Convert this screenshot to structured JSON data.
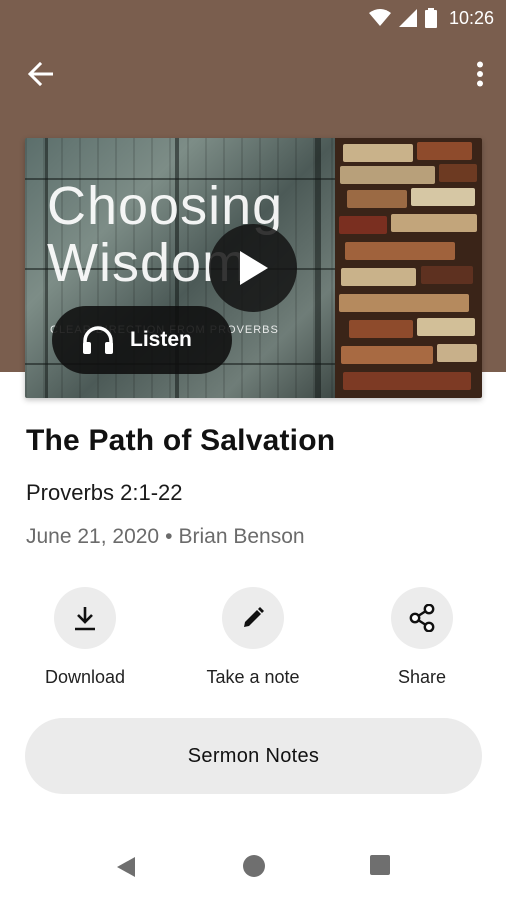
{
  "status_bar": {
    "time": "10:26"
  },
  "toolbar": {
    "back_icon": "arrow-left-icon",
    "menu_icon": "more-vertical-icon"
  },
  "media": {
    "artwork_title_line1": "Choosing",
    "artwork_title_line2": "Wisdom",
    "artwork_subtitle": "CLEAR DIRECTION FROM PROVERBS",
    "listen_label": "Listen"
  },
  "sermon": {
    "title": "The Path of Salvation",
    "passage": "Proverbs 2:1-22",
    "date": "June 21, 2020",
    "separator": "•",
    "speaker": "Brian Benson"
  },
  "actions": {
    "download_label": "Download",
    "note_label": "Take a note",
    "share_label": "Share"
  },
  "notes_button": {
    "label": "Sermon Notes"
  },
  "colors": {
    "header": "#7a5e4e",
    "button_bg": "#ebebeb"
  }
}
